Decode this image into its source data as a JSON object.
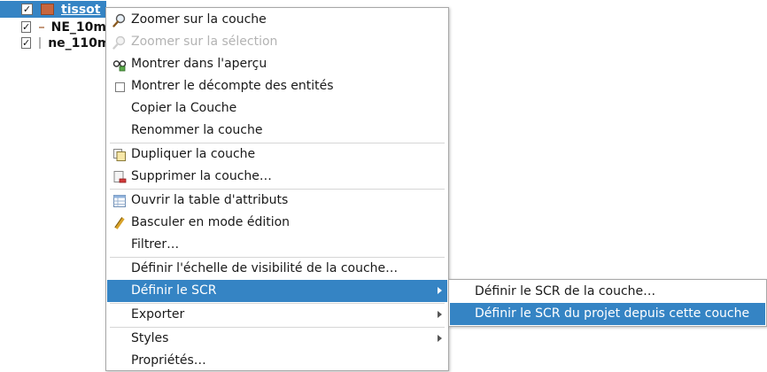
{
  "layer_tree": {
    "layers": [
      {
        "name": "tissot",
        "checked": "✓",
        "symbol": "fill-orange",
        "selected": true
      },
      {
        "name": "NE_10m",
        "checked": "✓",
        "symbol": "line",
        "selected": false
      },
      {
        "name": "ne_110m",
        "checked": "✓",
        "symbol": "fill-grey",
        "selected": false
      }
    ]
  },
  "context_menu": {
    "items": [
      {
        "label": "Zoomer sur la couche",
        "icon": "zoom-layer-icon"
      },
      {
        "label": "Zoomer sur la sélection",
        "icon": "zoom-selection-icon",
        "disabled": true
      },
      {
        "label": "Montrer dans l'aperçu",
        "icon": "overview-icon"
      },
      {
        "label": "Montrer le décompte des entités",
        "icon": "checkbox-icon"
      },
      {
        "label": "Copier la Couche"
      },
      {
        "label": "Renommer la couche"
      },
      {
        "label": "Dupliquer la couche",
        "icon": "duplicate-icon"
      },
      {
        "label": "Supprimer la couche…",
        "icon": "remove-layer-icon"
      },
      {
        "label": "Ouvrir la table d'attributs",
        "icon": "attribute-table-icon"
      },
      {
        "label": "Basculer en mode édition",
        "icon": "pencil-icon"
      },
      {
        "label": "Filtrer…"
      },
      {
        "label": "Définir l'échelle de visibilité de la couche…"
      },
      {
        "label": "Définir le SCR",
        "submenu": true,
        "active": true
      },
      {
        "label": "Exporter",
        "submenu": true
      },
      {
        "label": "Styles",
        "submenu": true
      },
      {
        "label": "Propriétés…"
      }
    ]
  },
  "submenu_crs": {
    "items": [
      {
        "label": "Définir le SCR de la couche…"
      },
      {
        "label": "Définir le SCR du projet depuis cette couche",
        "active": true
      }
    ]
  },
  "colors": {
    "selection": "#3584c4",
    "menu_border": "#a8a8a8",
    "disabled_text": "#b3b3b3",
    "layer_tissot_fill": "#c7663e"
  }
}
